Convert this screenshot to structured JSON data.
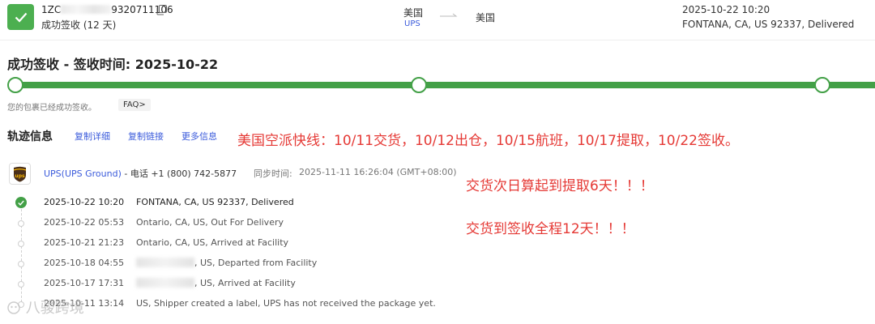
{
  "header": {
    "tracking_prefix": "1ZC",
    "tracking_suffix": "9320711106",
    "status_days": "成功签收 (12 天)",
    "origin_country": "美国",
    "carrier": "UPS",
    "destination_country": "美国",
    "latest_time": "2025-10-22 10:20",
    "latest_status": "FONTANA, CA, US 92337, Delivered"
  },
  "delivered_title": "成功签收 - 签收时间: 2025-10-22",
  "progress": {
    "steps_completed": 3,
    "steps_total": 3,
    "color": "#43a047"
  },
  "delivered_message": "您的包裹已经成功签收。",
  "faq_label": "FAQ>",
  "tracking": {
    "title": "轨迹信息",
    "links": [
      "复制详细",
      "复制链接",
      "更多信息"
    ],
    "carrier_label": "UPS(UPS Ground)",
    "phone": " - 电话 +1 (800) 742-5877",
    "sync_label": "同步时间:",
    "sync_time": "2025-11-11 16:26:04 (GMT+08:00)",
    "events": [
      {
        "time": "2025-10-22 10:20",
        "desc": "FONTANA, CA, US 92337, Delivered"
      },
      {
        "time": "2025-10-22 05:53",
        "desc": "Ontario, CA, US, Out For Delivery"
      },
      {
        "time": "2025-10-21 21:23",
        "desc": "Ontario, CA, US, Arrived at Facility"
      },
      {
        "time": "2025-10-18 04:55",
        "desc": ", US, Departed from Facility"
      },
      {
        "time": "2025-10-17 17:31",
        "desc": ", US, Arrived at Facility"
      },
      {
        "time": "2025-10-11 13:14",
        "desc": "US, Shipper created a label, UPS has not received the package yet."
      }
    ]
  },
  "annotations": [
    "美国空派快线：10/11交货，10/12出仓，10/15航班，10/17提取，10/22签收。",
    "交货次日算起到提取6天！！！",
    "交货到签收全程12天！！！"
  ],
  "watermark": "八骏跨境",
  "colors": {
    "accent_green": "#43a047",
    "link_blue": "#3b5bdb",
    "annotation_red": "#e53935"
  }
}
